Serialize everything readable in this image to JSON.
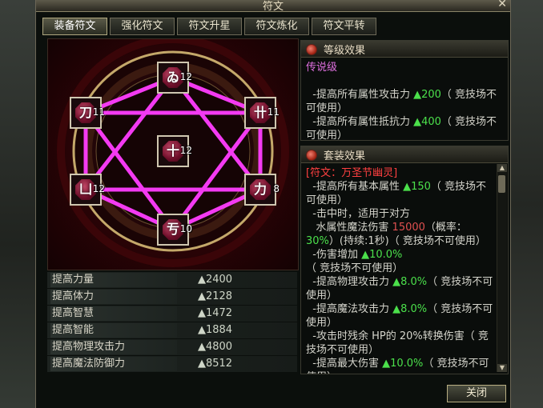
{
  "window": {
    "title": "符文"
  },
  "tabs": [
    "装备符文",
    "强化符文",
    "符文升星",
    "符文炼化",
    "符文平转"
  ],
  "runes": [
    {
      "glyph": "ゐ",
      "level": "12"
    },
    {
      "glyph": "刀",
      "level": "11"
    },
    {
      "glyph": "卄",
      "level": "11"
    },
    {
      "glyph": "十",
      "level": "12"
    },
    {
      "glyph": "凵",
      "level": "12"
    },
    {
      "glyph": "力",
      "level": "8"
    },
    {
      "glyph": "亐",
      "level": "10"
    }
  ],
  "stats": [
    {
      "name": "提高力量",
      "value": "▲2400"
    },
    {
      "name": "提高体力",
      "value": "▲2128"
    },
    {
      "name": "提高智慧",
      "value": "▲1472"
    },
    {
      "name": "提高智能",
      "value": "▲1884"
    },
    {
      "name": "提高物理攻击力",
      "value": "▲4800"
    },
    {
      "name": "提高魔法防御力",
      "value": "▲8512"
    }
  ],
  "level_panel": {
    "title": "等级效果",
    "grade": "传说级",
    "lines": [
      {
        "pre": "  -提高所有属性攻击力 ",
        "val": "▲200",
        "post": "（ 竞技场不可使用）"
      },
      {
        "pre": "  -提高所有属性抵抗力 ",
        "val": "▲400",
        "post": "（ 竞技场不可使用）"
      }
    ]
  },
  "set_panel": {
    "title": "套装效果",
    "set_name": "[符文：万圣节幽灵]",
    "lines": [
      {
        "pre": "  -提高所有基本属性 ",
        "val": "▲150",
        "post": "（ 竞技场不可使用）"
      },
      {
        "pre": "  -击中时，适用于对方",
        "val": "",
        "post": ""
      },
      {
        "pre": "   水属性魔法伤害 ",
        "val": "15000",
        "post": "（概率：",
        "val2": "30%",
        "post2": "）(持续:1秒)（ 竞技场不可使用）"
      },
      {
        "pre": "  -伤害增加 ",
        "val": "▲10.0%",
        "post": "（ 竞技场不可使用）"
      },
      {
        "pre": "  -提高物理攻击力 ",
        "val": "▲8.0%",
        "post": "（ 竞技场不可使用）"
      },
      {
        "pre": "  -提高魔法攻击力 ",
        "val": "▲8.0%",
        "post": "（ 竞技场不可使用）"
      },
      {
        "pre": "  -攻击时残余 HP的 20%转换伤害（ 竞技场不可使用）",
        "val": "",
        "post": ""
      },
      {
        "pre": "  -提高最大伤害 ",
        "val": "▲10.0%",
        "post": "（ 竞技场不可使用）"
      }
    ]
  },
  "close_button": "关闭",
  "colors": {
    "accent_green": "#4be04b",
    "rune_line": "#ff40ff",
    "grade": "#e070e0",
    "set_name": "#ff4040"
  }
}
